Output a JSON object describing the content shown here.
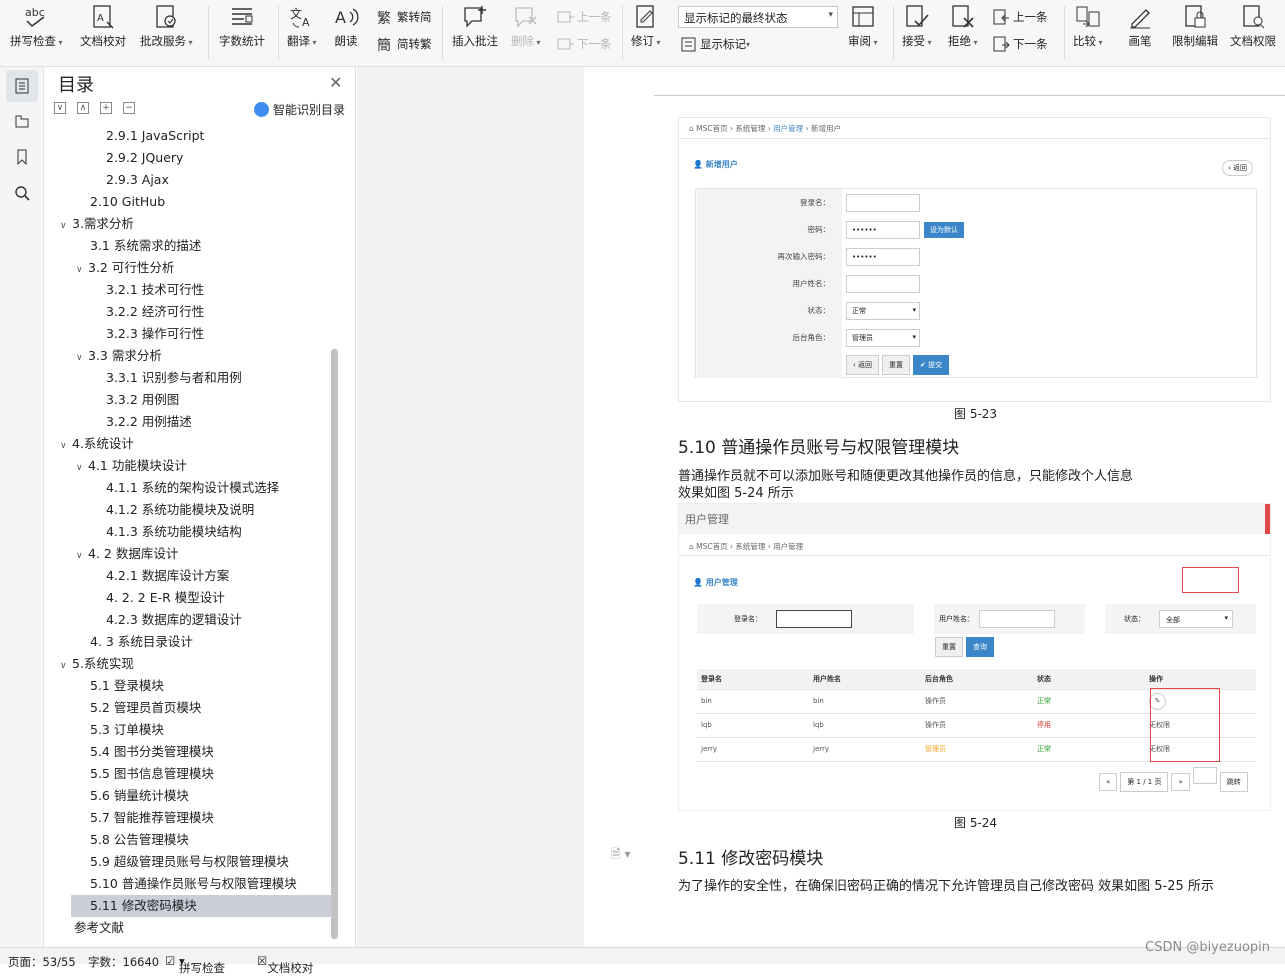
{
  "toolbar": {
    "spell_check": "拼写检查",
    "doc_proof": "文档校对",
    "batch_service": "批改服务",
    "word_count": "字数统计",
    "translate": "翻译",
    "read_aloud": "朗读",
    "trad_to_simp": "繁转简",
    "simp_to_trad": "简转繁",
    "insert_comment": "插入批注",
    "delete": "删除",
    "prev_comment": "上一条",
    "next_comment": "下一条",
    "revise": "修订",
    "markup_state": "显示标记的最终状态",
    "show_markup": "显示标记",
    "review": "审阅",
    "accept": "接受",
    "reject": "拒绝",
    "prev_change": "上一条",
    "next_change": "下一条",
    "compare": "比较",
    "pen": "画笔",
    "restrict_edit": "限制编辑",
    "doc_perm": "文档权限"
  },
  "nav": {
    "title": "目录",
    "smart_toc": "智能识别目录",
    "items": [
      {
        "text": "2.9.1 JavaScript",
        "level": 3
      },
      {
        "text": "2.9.2 JQuery",
        "level": 3
      },
      {
        "text": "2.9.3 Ajax",
        "level": 3
      },
      {
        "text": "2.10 GitHub",
        "level": 2
      },
      {
        "text": "3.需求分析",
        "level": 1
      },
      {
        "text": "3.1  系统需求的描述",
        "level": 2
      },
      {
        "text": "3.2  可行性分析",
        "level": 2
      },
      {
        "text": "3.2.1 技术可行性",
        "level": 3
      },
      {
        "text": "3.2.2 经济可行性",
        "level": 3
      },
      {
        "text": "3.2.3 操作可行性",
        "level": 3
      },
      {
        "text": "3.3  需求分析",
        "level": 2
      },
      {
        "text": "3.3.1  识别参与者和用例",
        "level": 3
      },
      {
        "text": "3.3.2  用例图",
        "level": 3
      },
      {
        "text": "3.2.2 用例描述",
        "level": 3
      },
      {
        "text": "4.系统设计",
        "level": 1
      },
      {
        "text": "4.1 功能模块设计",
        "level": 2
      },
      {
        "text": "4.1.1 系统的架构设计模式选择",
        "level": 3
      },
      {
        "text": "4.1.2 系统功能模块及说明",
        "level": 3
      },
      {
        "text": "4.1.3 系统功能模块结构",
        "level": 3
      },
      {
        "text": "4. 2 数据库设计",
        "level": 2
      },
      {
        "text": "4.2.1 数据库设计方案",
        "level": 3
      },
      {
        "text": "4. 2. 2  E-R 模型设计",
        "level": 3
      },
      {
        "text": "4.2.3 数据库的逻辑设计",
        "level": 3
      },
      {
        "text": "4. 3  系统目录设计",
        "level": 2
      },
      {
        "text": "5.系统实现",
        "level": 1
      },
      {
        "text": "5.1  登录模块",
        "level": 2
      },
      {
        "text": "5.2  管理员首页模块",
        "level": 2
      },
      {
        "text": "5.3  订单模块",
        "level": 2
      },
      {
        "text": "5.4  图书分类管理模块",
        "level": 2
      },
      {
        "text": "5.5  图书信息管理模块",
        "level": 2
      },
      {
        "text": "5.6  销量统计模块",
        "level": 2
      },
      {
        "text": "5.7  智能推荐管理模块",
        "level": 2
      },
      {
        "text": "5.8  公告管理模块",
        "level": 2
      },
      {
        "text": "5.9  超级管理员账号与权限管理模块",
        "level": 2
      },
      {
        "text": "5.10  普通操作员账号与权限管理模块",
        "level": 2
      },
      {
        "text": "5.11  修改密码模块",
        "level": 2
      },
      {
        "text": "参考文献",
        "level": 1
      }
    ]
  },
  "shot1": {
    "crumb_home": "MSC首页",
    "crumb_sys": "系统管理",
    "crumb_user": "用户管理",
    "crumb_new": "新增用户",
    "heading": "新增用户",
    "back_link": "‹ 返回",
    "f_login": "登录名：",
    "f_pwd": "密码：",
    "pwd_val": "••••••",
    "set_default": "设为默认",
    "f_pwd2": "再次输入密码：",
    "pwd2_val": "••••••",
    "f_name": "用户姓名：",
    "f_status": "状态：",
    "status_val": "正常",
    "f_role": "后台角色：",
    "role_val": "管理员",
    "btn_back": "‹ 返回",
    "btn_reset": "重置",
    "btn_submit": "✔ 提交"
  },
  "cap1": "图 5-23",
  "h_510": "5.10  普通操作员账号与权限管理模块",
  "para_510a": "普通操作员就不可以添加账号和随便更改其他操作员的信息，只能修改个人信息",
  "para_510b": "效果如图 5-24 所示",
  "shot2": {
    "title": "用户管理",
    "crumb_home": "MSC首页",
    "crumb_sys": "系统管理",
    "crumb_user": "用户管理",
    "heading": "用户管理",
    "s_login": "登录名：",
    "s_name": "用户姓名：",
    "s_status": "状态：",
    "status_val": "全部",
    "btn_reset": "重置",
    "btn_query": "查询",
    "cols": [
      "登录名",
      "用户姓名",
      "后台角色",
      "状态",
      "操作"
    ],
    "rows": [
      {
        "login": "bin",
        "name": "bin",
        "role": "操作员",
        "status": "正常",
        "op": "✎"
      },
      {
        "login": "lqb",
        "name": "lqb",
        "role": "操作员",
        "status": "停用",
        "op": "无权限"
      },
      {
        "login": "jerry",
        "name": "jerry",
        "role": "管理员",
        "status": "正常",
        "op": "无权限"
      }
    ],
    "page_info": "第 1 / 1 页",
    "jump": "跳转"
  },
  "cap2": "图 5-24",
  "h_511": "5.11  修改密码模块",
  "para_511": "为了操作的安全性，在确保旧密码正确的情况下允许管理员自己修改密码 效果如图 5-25 所示",
  "statusbar": {
    "page": "页面：53/55",
    "words": "字数：16640",
    "spell": "拼写检查",
    "proof": "文档校对"
  },
  "watermark": "CSDN @biyezuopin",
  "colors": {
    "accent": "#3a86c8",
    "ok": "#2e9c2e",
    "stop": "#d9342b",
    "admin": "#f0a020",
    "highlight": "#e04848"
  }
}
